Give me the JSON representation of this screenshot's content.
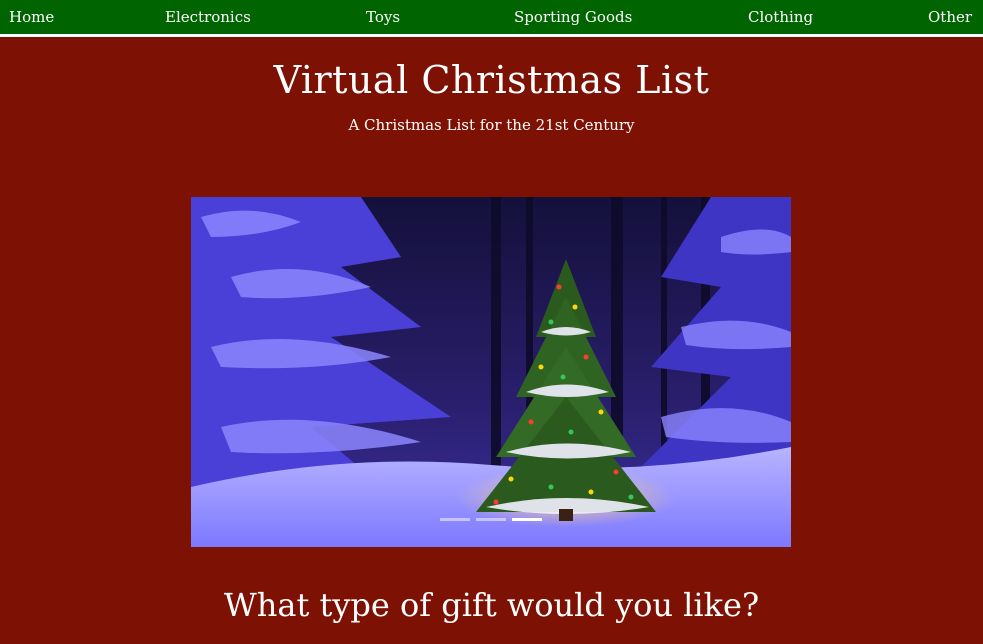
{
  "nav": {
    "items": [
      {
        "label": "Home"
      },
      {
        "label": "Electronics"
      },
      {
        "label": "Toys"
      },
      {
        "label": "Sporting Goods"
      },
      {
        "label": "Clothing"
      },
      {
        "label": "Other"
      }
    ]
  },
  "header": {
    "title": "Virtual Christmas List",
    "subtitle": "A Christmas List for the 21st Century"
  },
  "carousel": {
    "slide_count": 3,
    "active_slide": 3,
    "image_subject": "snow-covered-christmas-tree-in-forest"
  },
  "main": {
    "heading": "What type of gift would you like?"
  },
  "colors": {
    "page_background": "#7d1104",
    "nav_background": "#006400",
    "text": "#ffffff"
  }
}
